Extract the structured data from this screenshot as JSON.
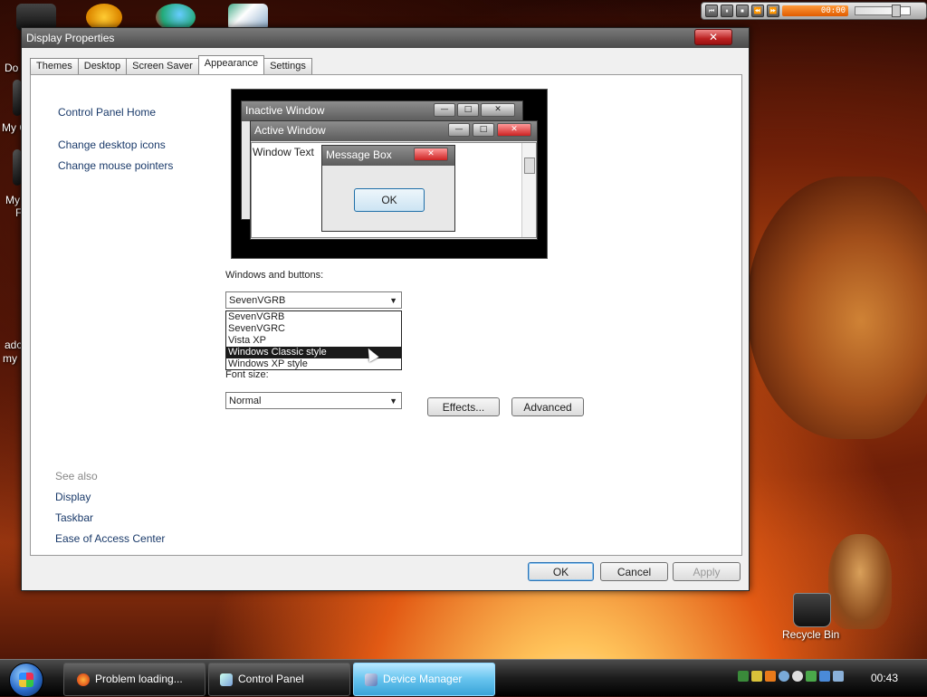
{
  "desktop": {
    "icon_labels": [
      "Do",
      "My C",
      "My",
      "F",
      "adc",
      "my"
    ],
    "recycle_bin": "Recycle Bin"
  },
  "media": {
    "time": "00:00",
    "controls": [
      "⏮",
      "⏸",
      "⏹",
      "⏪",
      "⏩"
    ]
  },
  "dialog": {
    "title": "Display Properties",
    "close": "✕",
    "tabs": [
      "Themes",
      "Desktop",
      "Screen Saver",
      "Appearance",
      "Settings"
    ],
    "active_tab": "Appearance",
    "left": {
      "home": "Control Panel Home",
      "links": [
        "Change desktop icons",
        "Change mouse pointers"
      ],
      "see_also": "See also",
      "see_also_links": [
        "Display",
        "Taskbar",
        "Ease of Access Center"
      ]
    },
    "preview": {
      "inactive_title": "Inactive Window",
      "active_title": "Active Window",
      "window_text": "Window Text",
      "message_title": "Message Box",
      "ok": "OK",
      "btn_min": "—",
      "btn_max": "□",
      "btn_close": "✕"
    },
    "windows_buttons_label": "Windows and buttons:",
    "windows_buttons_value": "SevenVGRB",
    "dropdown_options": [
      "SevenVGRB",
      "SevenVGRC",
      "Vista XP",
      "Windows Classic style",
      "Windows XP style"
    ],
    "dropdown_highlighted": "Windows Classic style",
    "font_size_label": "Font size:",
    "font_size_value": "Normal",
    "effects": "Effects...",
    "advanced": "Advanced",
    "ok": "OK",
    "cancel": "Cancel",
    "apply": "Apply"
  },
  "taskbar": {
    "tasks": [
      {
        "label": "Problem loading...",
        "icon": "firefox-icon",
        "color": "#e8782a"
      },
      {
        "label": "Control Panel",
        "icon": "control-panel-icon",
        "color": "#7aa0d8"
      },
      {
        "label": "Device Manager",
        "icon": "device-manager-icon",
        "color": "#5a7ab8"
      }
    ],
    "clock": "00:43"
  }
}
